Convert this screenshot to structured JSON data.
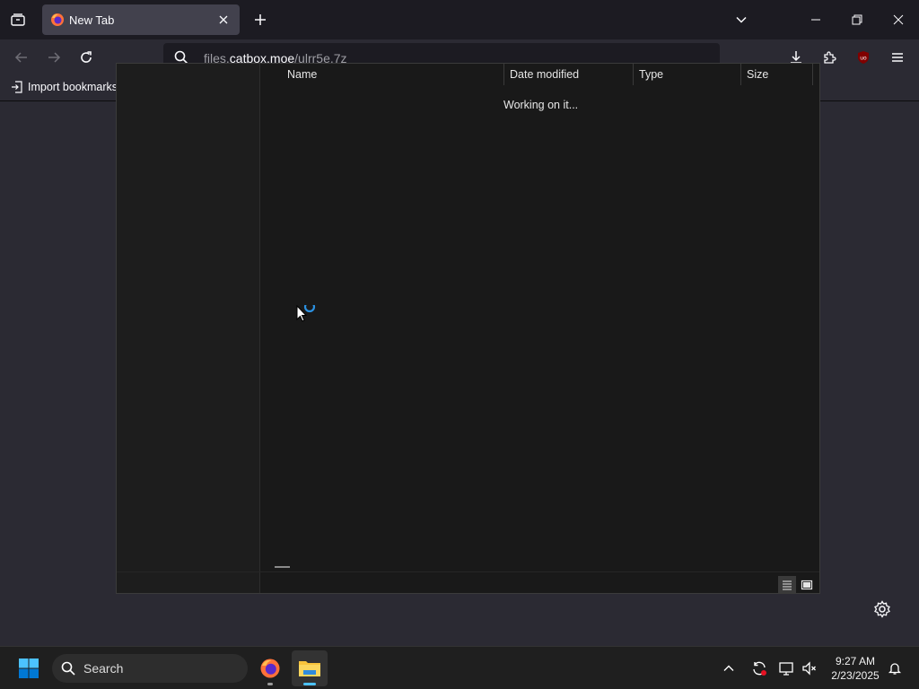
{
  "browser": {
    "tab": {
      "title": "New Tab"
    },
    "url": {
      "scheme_prefix": "files.",
      "host": "catbox.moe",
      "path": "/ulrr5e.7z"
    },
    "bookmarks_toolbar": {
      "import_label": "Import bookmarks"
    }
  },
  "dialog": {
    "columns": [
      "Name",
      "Date modified",
      "Type",
      "Size"
    ],
    "status": "Working on it..."
  },
  "taskbar": {
    "search_label": "Search",
    "clock": {
      "time": "9:27 AM",
      "date": "2/23/2025"
    }
  },
  "colors": {
    "accent_blue": "#0a84ff",
    "ublock_red": "#800000",
    "windows_blue": "#0078d4"
  },
  "icons": [
    "tab-list-icon",
    "firefox-logo-icon",
    "close-icon",
    "new-tab-plus-icon",
    "chevron-down-icon",
    "minimize-icon",
    "restore-icon",
    "back-arrow-icon",
    "forward-arrow-icon",
    "reload-icon",
    "search-icon",
    "download-icon",
    "extensions-icon",
    "ublock-icon",
    "hamburger-menu-icon",
    "import-icon",
    "details-view-icon",
    "thumbnail-view-icon",
    "gear-icon",
    "windows-start-icon",
    "file-explorer-icon",
    "tray-chevron-icon",
    "sync-icon",
    "display-icon",
    "volume-muted-icon",
    "notification-bell-icon",
    "busy-cursor-icon"
  ]
}
